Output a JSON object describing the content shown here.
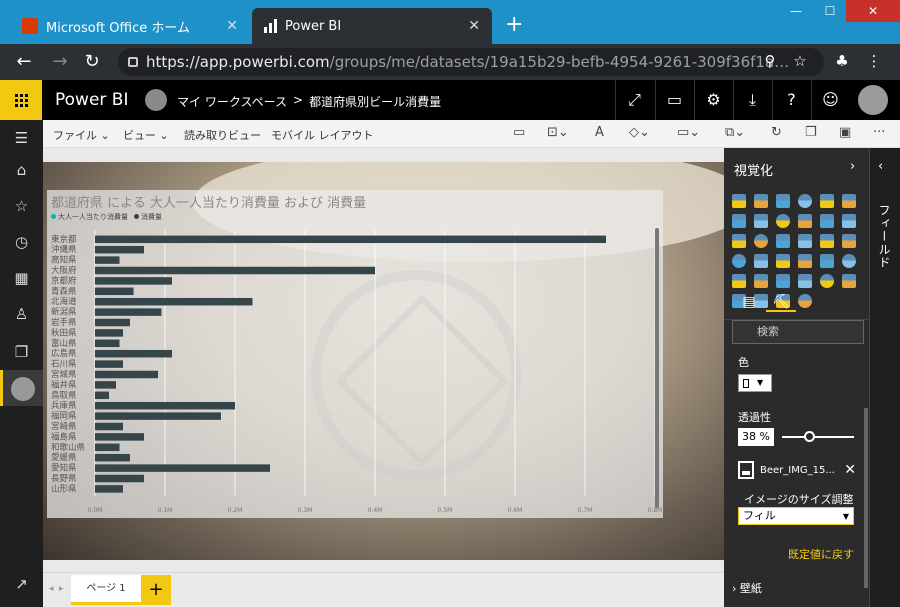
{
  "browser": {
    "tabs": [
      {
        "label": "Microsoft Office ホーム"
      },
      {
        "label": "Power BI"
      }
    ],
    "url_host": "https://app.powerbi.com",
    "url_path": "/groups/me/datasets/19a15b29-befb-4954-9261-309f36f1a…"
  },
  "header": {
    "brand": "Power BI",
    "workspace": "マイ ワークスペース",
    "separator": ">",
    "report": "都道府県別ビール消費量"
  },
  "toolbar": {
    "file": "ファイル",
    "view": "ビュー",
    "reading_view": "読み取りビュー",
    "mobile_layout": "モバイル レイアウト"
  },
  "visual": {
    "title": "都道府県 による 大人一人当たり消費量 および 消費量",
    "legend": [
      "大人一人当たり消費量",
      "消費量"
    ]
  },
  "chart_data": {
    "type": "bar",
    "orientation": "horizontal",
    "categories": [
      "東京都",
      "沖縄県",
      "高知県",
      "大阪府",
      "京都府",
      "青森県",
      "北海道",
      "新潟県",
      "岩手県",
      "秋田県",
      "富山県",
      "広島県",
      "石川県",
      "宮城県",
      "福井県",
      "鳥取県",
      "兵庫県",
      "福岡県",
      "宮崎県",
      "福島県",
      "和歌山県",
      "愛媛県",
      "愛知県",
      "長野県",
      "山形県"
    ],
    "series": [
      {
        "name": "消費量",
        "values": [
          0.73,
          0.07,
          0.035,
          0.4,
          0.11,
          0.055,
          0.225,
          0.095,
          0.05,
          0.04,
          0.035,
          0.11,
          0.04,
          0.09,
          0.03,
          0.02,
          0.2,
          0.18,
          0.04,
          0.07,
          0.035,
          0.05,
          0.25,
          0.07,
          0.04
        ]
      }
    ],
    "xticks": [
      "0.0M",
      "0.1M",
      "0.2M",
      "0.3M",
      "0.4M",
      "0.5M",
      "0.6M",
      "0.7M",
      "0.8M"
    ],
    "xlim": [
      0,
      0.8
    ],
    "legend_position": "top-left",
    "bar_color": "#36454a",
    "legend_colors": [
      "#01b8aa",
      "#36454a"
    ]
  },
  "pages": {
    "tab": "ページ 1",
    "add": "+"
  },
  "viz_pane": {
    "title": "視覚化",
    "search_placeholder": "検索",
    "color_label": "色",
    "transparency_label": "透過性",
    "transparency_value": "38",
    "transparency_unit": "%",
    "transparency_fraction": 0.38,
    "image_name": "Beer_IMG_15...",
    "size_label": "イメージのサイズ調整",
    "size_value": "フィル",
    "reset": "既定値に戻す",
    "wallpaper": "壁紙",
    "viz_colors": [
      "#f2c811",
      "#e8a33b",
      "#4aa4d6",
      "#88c1e8"
    ]
  },
  "fields_pane": {
    "label": "フィールド"
  },
  "colors": {
    "accent": "#f2c811",
    "chrome": "#1e91c9",
    "dark": "#2b2b2b"
  }
}
